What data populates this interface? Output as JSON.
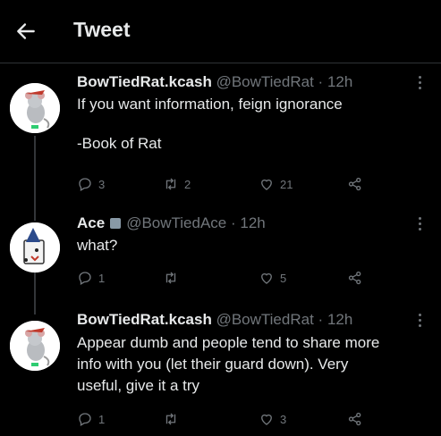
{
  "header": {
    "back_icon": "arrow-left-icon",
    "title": "Tweet"
  },
  "tweets": [
    {
      "name": "BowTiedRat.kcash",
      "handle": "@BowTiedRat",
      "dot": "·",
      "time": "12h",
      "lines": [
        "If you want information, feign ignorance",
        "-Book of Rat"
      ],
      "counts": {
        "reply": "3",
        "retweet": "2",
        "like": "21"
      }
    },
    {
      "name": "Ace",
      "handle": "@BowTiedAce",
      "dot": "·",
      "time": "12h",
      "lines": [
        "what?"
      ],
      "counts": {
        "reply": "1",
        "retweet": "",
        "like": "5"
      }
    },
    {
      "name": "BowTiedRat.kcash",
      "handle": "@BowTiedRat",
      "dot": "·",
      "time": "12h",
      "lines": [
        "Appear dumb and people tend to share more",
        "info with you (let their guard down). Very",
        "useful, give it a try"
      ],
      "counts": {
        "reply": "1",
        "retweet": "",
        "like": "3"
      }
    }
  ],
  "colors": {
    "background": "#000000",
    "text": "#e7e9ea",
    "muted": "#71767b",
    "divider": "#2f3336"
  }
}
